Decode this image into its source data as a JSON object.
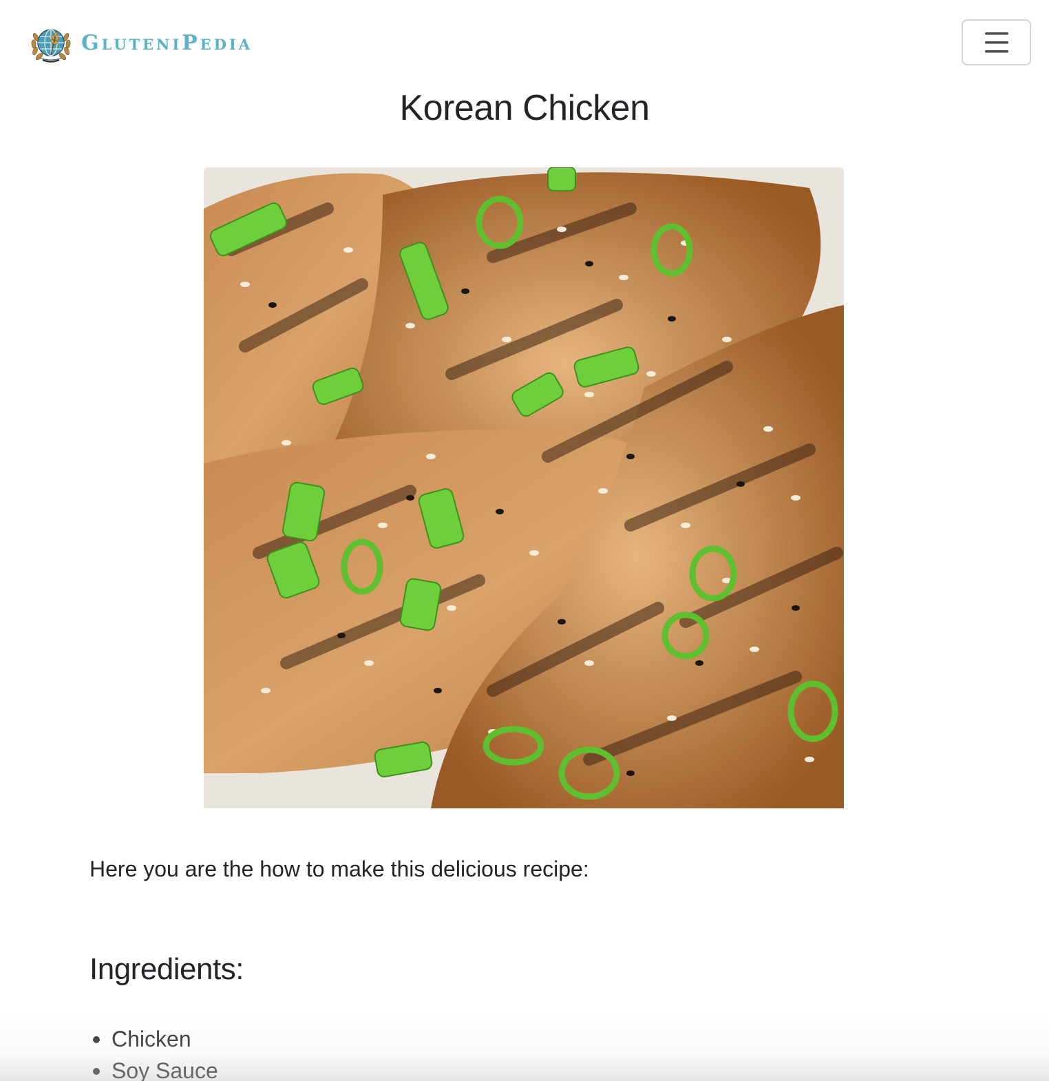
{
  "header": {
    "brand_name": "GluteniPedia",
    "logo_icon": "globe-wheat-logo-icon",
    "menu_icon": "hamburger-menu-icon",
    "brand_color": "#5bb1c7"
  },
  "recipe": {
    "title": "Korean Chicken",
    "photo_subject": "grilled-korean-chicken-photo",
    "intro": "Here you are the how to make this delicious recipe:",
    "ingredients_heading": "Ingredients:",
    "ingredients": [
      "Chicken",
      "Soy Sauce"
    ]
  }
}
